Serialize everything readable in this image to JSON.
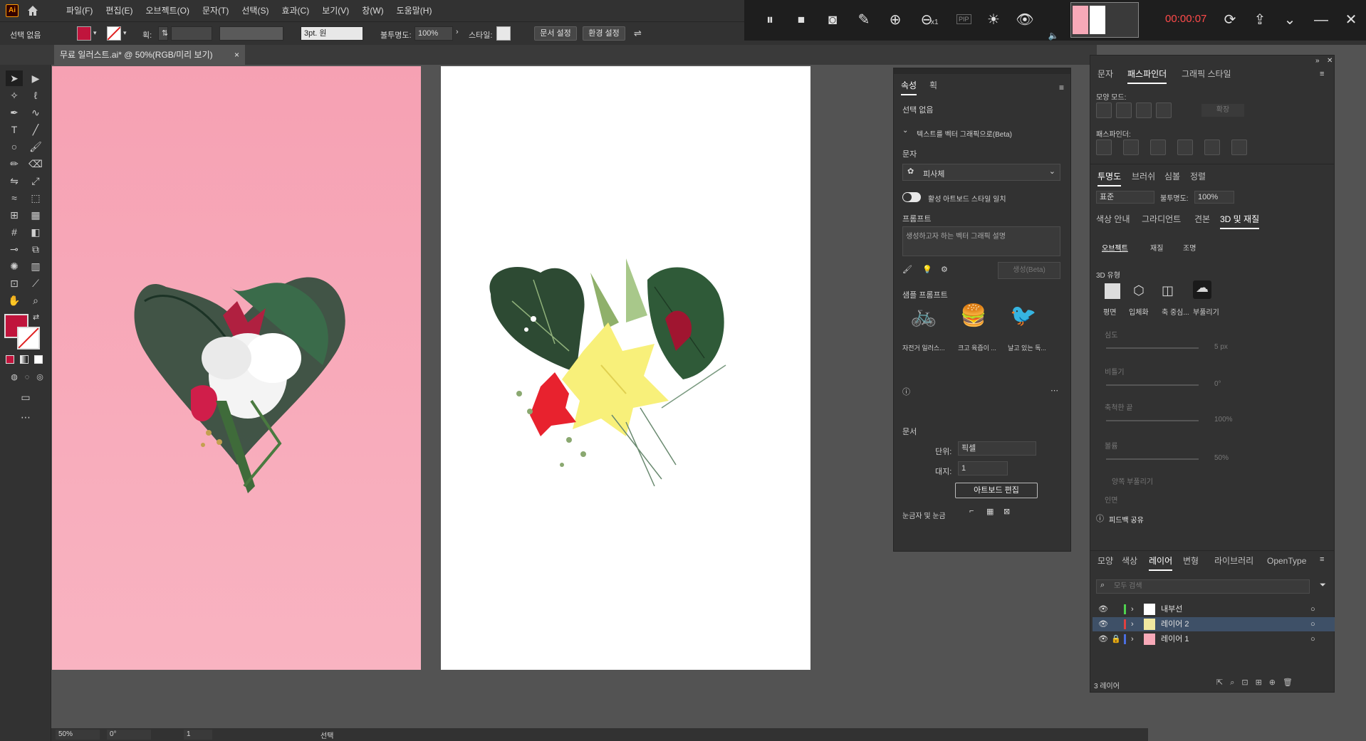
{
  "app": {
    "logo": "Ai"
  },
  "menu": [
    "파일(F)",
    "편집(E)",
    "오브젝트(O)",
    "문자(T)",
    "선택(S)",
    "효과(C)",
    "보기(V)",
    "창(W)",
    "도움말(H)"
  ],
  "recorder": {
    "timer": "00:00:07",
    "zoom_multiplier": "x1",
    "pip_label": "PIP"
  },
  "control_bar": {
    "selection": "선택 없음",
    "fill_color": "#c0143c",
    "stroke_label": "획:",
    "brush_label": "3pt. 원",
    "opacity_label": "불투명도:",
    "opacity_value": "100%",
    "style_label": "스타일:",
    "doc_setup": "문서 설정",
    "preferences": "환경 설정"
  },
  "document_tab": {
    "title": "무료 일러스트.ai* @ 50%(RGB/미리 보기)",
    "close": "×"
  },
  "properties_panel": {
    "tabs": [
      "속성",
      "획"
    ],
    "selection": "선택 없음",
    "text_to_vector": "텍스트를 벡터 그래픽으로(Beta)",
    "subject_label": "문자",
    "subject_value": "피사체",
    "toggle_label": "활성 아트보드 스타일 일치",
    "prompt_label": "프롬프트",
    "prompt_placeholder": "생성하고자 하는 벡터 그래픽 설명",
    "generate_btn": "생성(Beta)",
    "sample_prompts_label": "샘플 프롬프트",
    "samples": [
      "자전거 일러스...",
      "크고 육즙이 ...",
      "날고 있는 독..."
    ],
    "document_label": "문서",
    "units_label": "단위:",
    "units_value": "픽셀",
    "artboard_label": "대지:",
    "artboard_value": "1",
    "edit_artboards": "아트보드 편집",
    "rulers_label": "눈금자 및 눈금"
  },
  "right_panel_top": {
    "tabs": [
      "문자",
      "패스파인더",
      "그래픽 스타일"
    ],
    "shape_modes": "모양 모드:",
    "expand": "확장",
    "pathfinders": "패스파인더:"
  },
  "transparency_panel": {
    "tabs": [
      "투명도",
      "브러쉬",
      "심볼",
      "정렬"
    ],
    "blend_mode": "표준",
    "opacity_label": "불투명도:",
    "opacity_value": "100%"
  },
  "3d_panel": {
    "tabs": [
      "색상 안내",
      "그라디언트",
      "견본",
      "3D 및 재질"
    ],
    "subtabs": [
      "오브젝트",
      "재질",
      "조명"
    ],
    "type_label": "3D 유형",
    "types": [
      "평면",
      "입체화",
      "축 중심...",
      "부풀리기"
    ],
    "depth_label": "심도",
    "depth_value": "5 px",
    "twist_label": "비틀기",
    "twist_value": "0°",
    "taper_label": "축척한 끝",
    "taper_value": "100%",
    "volume_label": "볼륨",
    "volume_value": "50%",
    "both_sides": "양쪽 부풀리기",
    "cap_label": "인면",
    "feedback": "피드백 공유"
  },
  "layers_panel": {
    "tabs": [
      "모양",
      "색상",
      "레이어",
      "변형",
      "라이브러리",
      "OpenType"
    ],
    "search_placeholder": "모두 검색",
    "layers": [
      {
        "name": "내부선",
        "color": "#4fd24f"
      },
      {
        "name": "레이어 2",
        "color": "#e04040"
      },
      {
        "name": "레이어 1",
        "color": "#4a6ee0"
      }
    ],
    "count": "3 레이어"
  },
  "status_bar": {
    "zoom": "50%",
    "rotation": "0°",
    "artboard": "1",
    "tool": "선택"
  }
}
